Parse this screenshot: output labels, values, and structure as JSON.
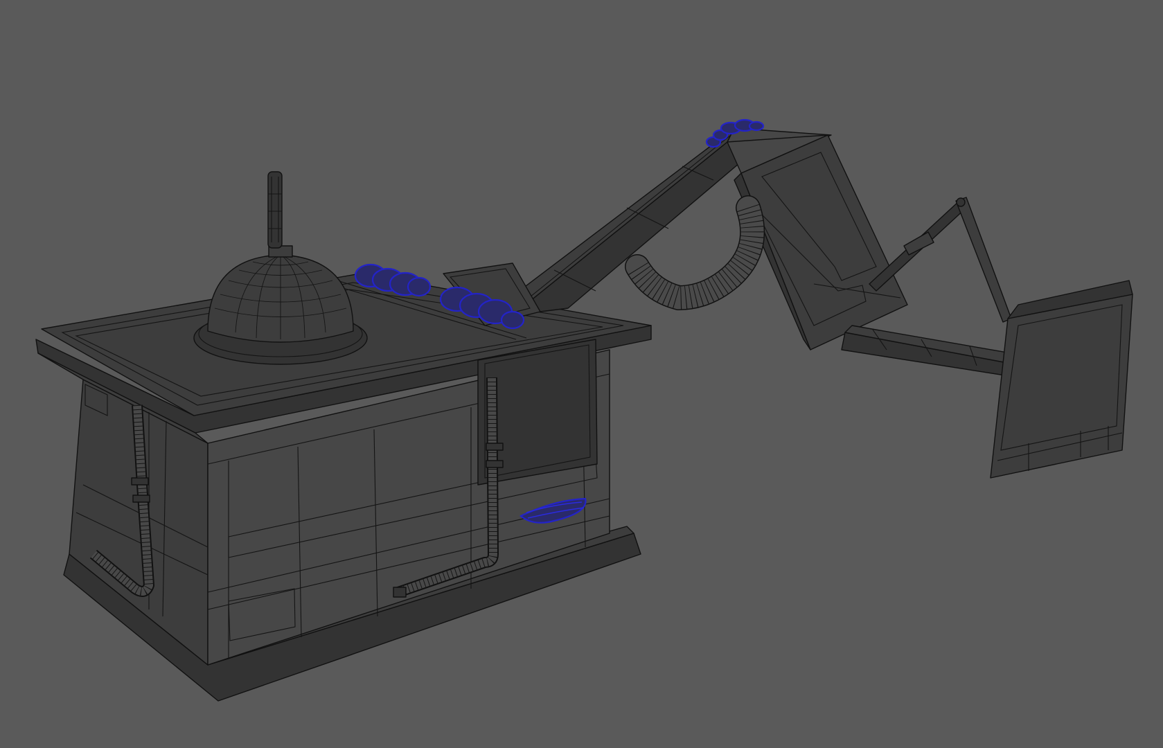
{
  "viewport": {
    "background_color": "#5a5a5a",
    "display_mode": "wireframe-on-shaded",
    "selection_color": "#2323c8",
    "mesh_color": "#3d3d3d",
    "wire_color": "#111111"
  },
  "scene": {
    "objects": [
      {
        "name": "base-cabinet",
        "selected": false
      },
      {
        "name": "dome-cap",
        "selected": false
      },
      {
        "name": "antenna-rod",
        "selected": false
      },
      {
        "name": "arm-upper-beam",
        "selected": false
      },
      {
        "name": "arm-elbow-housing",
        "selected": false
      },
      {
        "name": "flexible-hose",
        "selected": false
      },
      {
        "name": "piston-rod",
        "selected": false
      },
      {
        "name": "arm-lower-beam",
        "selected": false
      },
      {
        "name": "end-panel",
        "selected": false
      },
      {
        "name": "pipe-left",
        "selected": false
      },
      {
        "name": "pipe-front",
        "selected": false
      },
      {
        "name": "coil-springs",
        "selected": true
      }
    ]
  }
}
